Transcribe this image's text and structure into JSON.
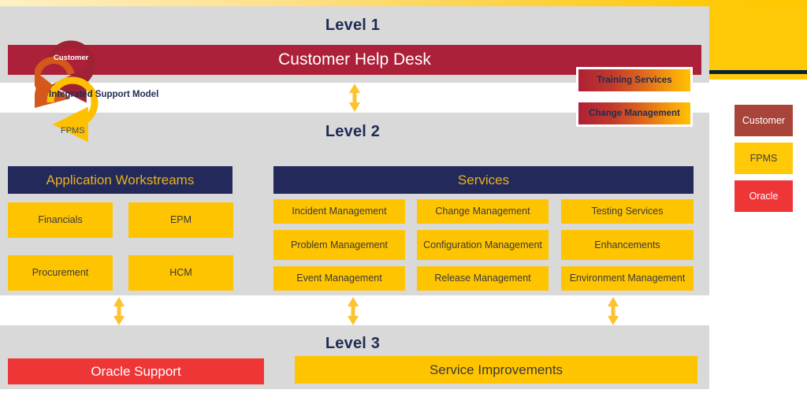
{
  "theme": {
    "band_gray": "#d9d9d9",
    "navy": "#23295a",
    "dark_red": "#ad2039",
    "yellow": "#ffc400",
    "bright_red": "#ef3637",
    "legend_customer": "#a9443a",
    "accent_gold": "#e8b21e"
  },
  "levels": {
    "level1_label": "Level 1",
    "level2_label": "Level 2",
    "level3_label": "Level 3"
  },
  "help_desk": {
    "label": "Customer Help Desk"
  },
  "callouts": [
    {
      "label": "Training Services"
    },
    {
      "label": "Change Management"
    }
  ],
  "rings": {
    "title": "Integrated Support Model",
    "customer_label": "Customer",
    "fpms_label": "FPMS"
  },
  "legend": {
    "items": [
      {
        "label": "Customer",
        "color": "#a9443a"
      },
      {
        "label": "FPMS",
        "color": "#ffc907"
      },
      {
        "label": "Oracle",
        "color": "#ef3637"
      }
    ]
  },
  "workstreams": {
    "header": "Application Workstreams",
    "tiles": [
      {
        "label": "Financials"
      },
      {
        "label": "EPM"
      },
      {
        "label": "Procurement"
      },
      {
        "label": "HCM"
      }
    ]
  },
  "services": {
    "header": "Services",
    "tiles": [
      {
        "label": "Incident Management"
      },
      {
        "label": "Change Management"
      },
      {
        "label": "Testing Services"
      },
      {
        "label": "Problem  Management"
      },
      {
        "label": "Configuration Management"
      },
      {
        "label": "Enhancements"
      },
      {
        "label": "Event Management"
      },
      {
        "label": "Release Management"
      },
      {
        "label": "Environment  Management"
      }
    ]
  },
  "level3": {
    "oracle_support": "Oracle Support",
    "service_improvements": "Service Improvements"
  }
}
